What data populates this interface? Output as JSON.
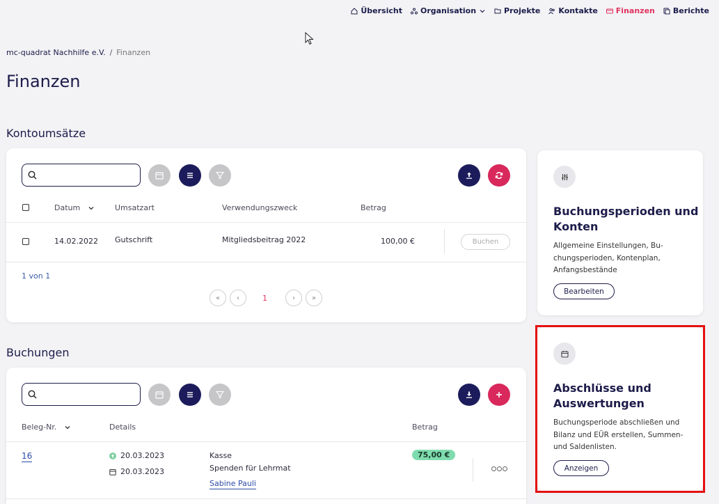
{
  "nav": {
    "items": [
      {
        "label": "Übersicht",
        "icon": "home-icon",
        "active": false
      },
      {
        "label": "Organisation",
        "icon": "organisation-icon",
        "active": false,
        "dropdown": true
      },
      {
        "label": "Projekte",
        "icon": "folder-icon",
        "active": false
      },
      {
        "label": "Kontakte",
        "icon": "contacts-icon",
        "active": false
      },
      {
        "label": "Finanzen",
        "icon": "finance-icon",
        "active": true
      },
      {
        "label": "Berichte",
        "icon": "reports-icon",
        "active": false
      }
    ]
  },
  "breadcrumb": {
    "org": "mc-quadrat Nachhilfe e.V.",
    "separator": "/",
    "current": "Finanzen"
  },
  "page_title": "Finanzen",
  "kontoumsaetze": {
    "title": "Kontoumsätze",
    "search_placeholder": "",
    "columns": {
      "datum": "Datum",
      "umsatzart": "Umsatzart",
      "verwendungszweck": "Verwendungszweck",
      "betrag": "Betrag"
    },
    "rows": [
      {
        "datum": "14.02.2022",
        "umsatzart": "Gutschrift",
        "verwendungszweck": "Mitgliedsbeitrag 2022",
        "betrag": "100,00 €",
        "action": "Buchen"
      }
    ],
    "pagination": {
      "summary": "1 von 1",
      "first": "«",
      "prev": "‹",
      "current": "1",
      "next": "›",
      "last": "»"
    }
  },
  "buchungen": {
    "title": "Buchungen",
    "search_placeholder": "",
    "columns": {
      "beleg": "Beleg-Nr.",
      "details": "Details",
      "betrag": "Betrag"
    },
    "rows": [
      {
        "beleg": "16",
        "date_booked": "20.03.2023",
        "date_doc": "20.03.2023",
        "konto": "Kasse",
        "zweck": "Spenden für Lehrmat",
        "person": "Sabine Pauli",
        "betrag": "75,00 €"
      }
    ]
  },
  "side_cards": [
    {
      "icon": "sliders-icon",
      "title_line1": "Buchungsperioden und",
      "title_line2": "Konten",
      "text_line1": "Allgemeine Einstellungen, Bu-",
      "text_line2": "chungsperioden, Kontenplan,",
      "text_line3": "Anfangsbestände",
      "button": "Bearbeiten"
    },
    {
      "icon": "calendar-icon",
      "title_line1": "Abschlüsse und",
      "title_line2": "Auswertungen",
      "text_line1": "Buchungsperiode abschließen und",
      "text_line2": "Bilanz und EÜR erstellen, Summen-",
      "text_line3": "und Saldenlisten.",
      "button": "Anzeigen"
    }
  ],
  "colors": {
    "navy": "#1c1c5c",
    "pink": "#d8285c",
    "accent": "#e0335e",
    "badge": "#7fdcae",
    "highlight": "#e51010"
  }
}
